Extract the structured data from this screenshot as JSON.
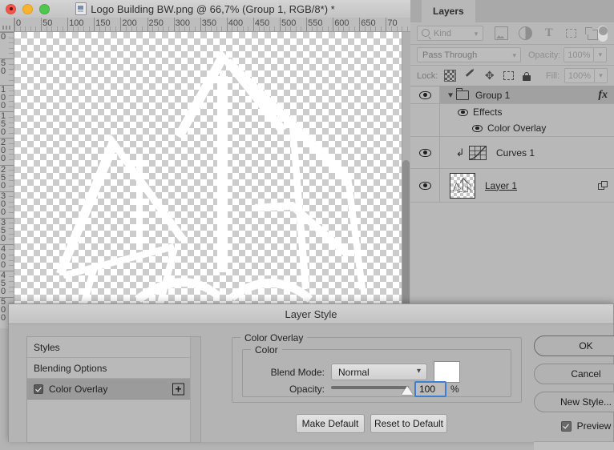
{
  "window": {
    "title": "Logo Building BW.png @ 66,7% (Group 1, RGB/8*) *",
    "traffic_lights": [
      "close",
      "minimize",
      "zoom"
    ],
    "doc_icon": "png-file-icon"
  },
  "rulers": {
    "horizontal_labels": [
      "0",
      "50",
      "100",
      "150",
      "200",
      "250",
      "300",
      "350",
      "400",
      "450",
      "500",
      "550",
      "600",
      "650",
      "70"
    ],
    "vertical_labels": [
      "0",
      "50",
      "100",
      "150",
      "200",
      "250",
      "300",
      "350",
      "400",
      "450",
      "500"
    ],
    "unit_step": 50
  },
  "canvas": {
    "artwork_alt": "white abstract building logo on transparent checkerboard",
    "background": "transparent-checkerboard"
  },
  "layers_panel": {
    "tab_label": "Layers",
    "filter": {
      "kind_label": "Kind",
      "icons": [
        "image-filter-icon",
        "adjustment-filter-icon",
        "type-filter-icon",
        "shape-filter-icon",
        "smart-object-filter-icon"
      ],
      "toggle_name": "filter-toggle"
    },
    "blend": {
      "mode": "Pass Through",
      "opacity_label": "Opacity:",
      "opacity_value": "100%"
    },
    "lock": {
      "label": "Lock:",
      "icons": [
        "lock-transparent-pixels-icon",
        "lock-image-pixels-icon",
        "lock-position-icon",
        "lock-artboard-icon",
        "lock-all-icon"
      ],
      "fill_label": "Fill:",
      "fill_value": "100%"
    },
    "rows": [
      {
        "name": "Group 1",
        "type": "group",
        "selected": true,
        "visible": true,
        "has_fx": true,
        "fx_badge": "fx",
        "effects_label": "Effects",
        "effect_items": [
          "Color Overlay"
        ]
      },
      {
        "name": "Curves 1",
        "type": "adjustment",
        "selected": false,
        "visible": true,
        "clipped": true
      },
      {
        "name": "Layer 1",
        "type": "pixel",
        "selected": false,
        "visible": true,
        "has_mask_badge": true
      }
    ]
  },
  "dialog": {
    "title": "Layer Style",
    "styles_list": [
      {
        "label": "Styles",
        "checkbox": false,
        "active": false,
        "plus": false
      },
      {
        "label": "Blending Options",
        "checkbox": false,
        "active": false,
        "plus": false
      },
      {
        "label": "Color Overlay",
        "checkbox": true,
        "checked": true,
        "active": true,
        "plus": true,
        "plus_label": "+"
      }
    ],
    "color_overlay": {
      "group_title": "Color Overlay",
      "color_group_title": "Color",
      "blend_mode_label": "Blend Mode:",
      "blend_mode_value": "Normal",
      "swatch_color": "#ffffff",
      "opacity_label": "Opacity:",
      "opacity_value": "100",
      "opacity_unit": "%",
      "make_default": "Make Default",
      "reset_to_default": "Reset to Default"
    },
    "buttons": {
      "ok": "OK",
      "cancel": "Cancel",
      "new_style": "New Style...",
      "preview_label": "Preview",
      "preview_checked": true
    }
  },
  "colors": {
    "panel_bg": "#b8b8b8",
    "dialog_bg": "#b4b4b4",
    "selection": "#a1a1a1",
    "focus_ring": "#3d7fd1",
    "swatch": "#ffffff"
  }
}
